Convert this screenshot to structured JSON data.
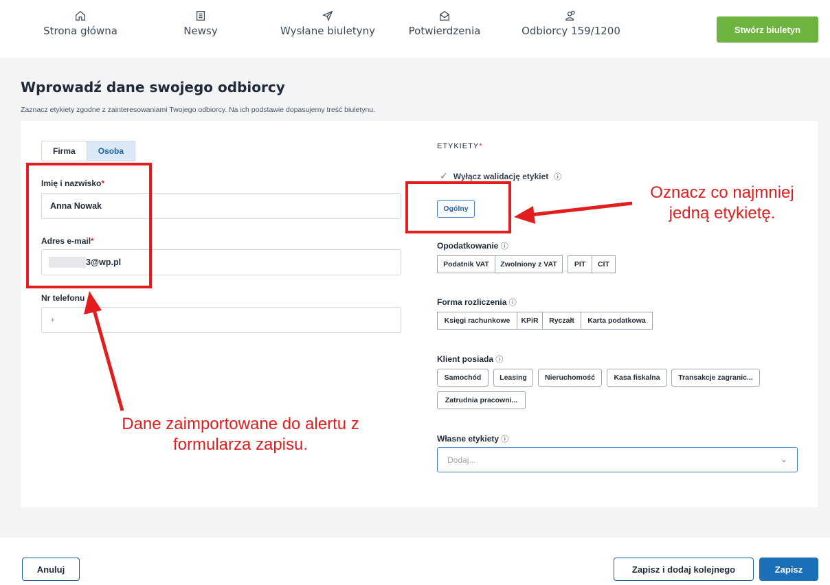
{
  "nav": {
    "items": [
      {
        "label": "Strona główna",
        "icon": "home-icon"
      },
      {
        "label": "Newsy",
        "icon": "newspaper-icon"
      },
      {
        "label": "Wysłane biuletyny",
        "icon": "send-icon"
      },
      {
        "label": "Potwierdzenia",
        "icon": "envelope-open-icon"
      },
      {
        "label": "Odbiorcy 159/1200",
        "icon": "users-icon"
      }
    ],
    "create_label": "Stwórz biuletyn"
  },
  "page": {
    "title": "Wprowadź dane swojego odbiorcy",
    "subtitle": "Zaznacz etykiety zgodne z zainteresowaniami Twojego odbiorcy. Na ich podstawie dopasujemy treść biuletynu."
  },
  "form": {
    "type_tabs": [
      "Firma",
      "Osoba"
    ],
    "selected_type": "Osoba",
    "name_label": "Imię i nazwisko",
    "name_value": "Anna Nowak",
    "email_label": "Adres e-mail",
    "email_value": "3@wp.pl",
    "phone_label": "Nr telefonu",
    "phone_placeholder": "+"
  },
  "tags": {
    "section_title": "ETYKIETY",
    "required_mark": "*",
    "disable_validation_label": "Wyłącz walidację etykiet",
    "general": "Ogólny",
    "taxation_label": "Opodatkowanie",
    "taxation": [
      "Podatnik VAT",
      "Zwolniony z VAT",
      "PIT",
      "CIT"
    ],
    "settlement_label": "Forma rozliczenia",
    "settlement": [
      "Księgi rachunkowe",
      "KPiR",
      "Ryczałt",
      "Karta podatkowa"
    ],
    "client_has_label": "Klient posiada",
    "client_has": [
      "Samochód",
      "Leasing",
      "Nieruchomość",
      "Kasa fiskalna",
      "Transakcje zagranic...",
      "Zatrudnia pracowni..."
    ],
    "custom_label": "Własne etykiety",
    "custom_placeholder": "Dodaj...",
    "info_icon": "ⓘ"
  },
  "annotations": {
    "right": "Oznacz co najmniej\njedną etykietę.",
    "left": "Dane zaimportowane do alertu z\nformularza zapisu.",
    "color": "#e11d1d"
  },
  "footer": {
    "cancel_label": "Anuluj",
    "save_add_label": "Zapisz i dodaj kolejnego",
    "save_label": "Zapisz"
  }
}
